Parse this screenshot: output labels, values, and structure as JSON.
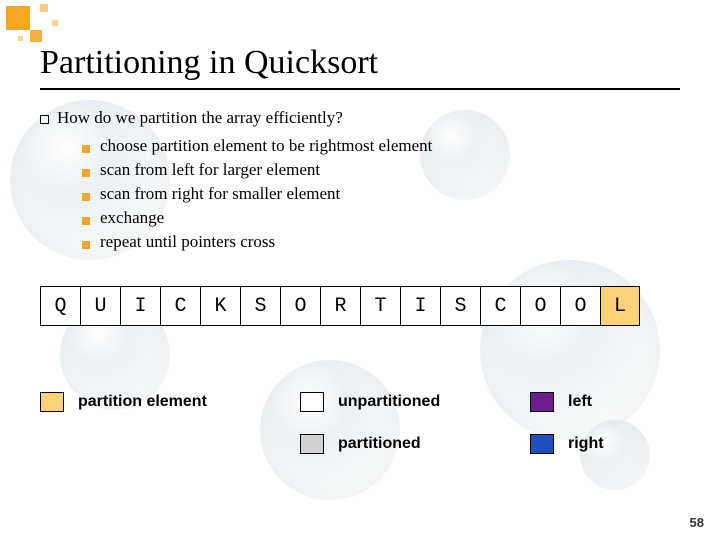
{
  "slide": {
    "title": "Partitioning in Quicksort",
    "lead": "How do we partition the array efficiently?",
    "bullets": [
      "choose partition element to be rightmost element",
      "scan from left for larger element",
      "scan from right for smaller element",
      "exchange",
      "repeat until pointers cross"
    ],
    "array": [
      "Q",
      "U",
      "I",
      "C",
      "K",
      "S",
      "O",
      "R",
      "T",
      "I",
      "S",
      "C",
      "O",
      "O",
      "L"
    ],
    "partition_index": 14,
    "legend": {
      "partition_element": "partition element",
      "unpartitioned": "unpartitioned",
      "partitioned": "partitioned",
      "left": "left",
      "right": "right"
    },
    "page_number": "58",
    "colors": {
      "accent": "#f5a623",
      "partition_swatch": "#ffd27a",
      "left_swatch": "#6b1f8e",
      "right_swatch": "#1f4fbf",
      "partitioned_swatch": "#d0d0d0"
    }
  }
}
